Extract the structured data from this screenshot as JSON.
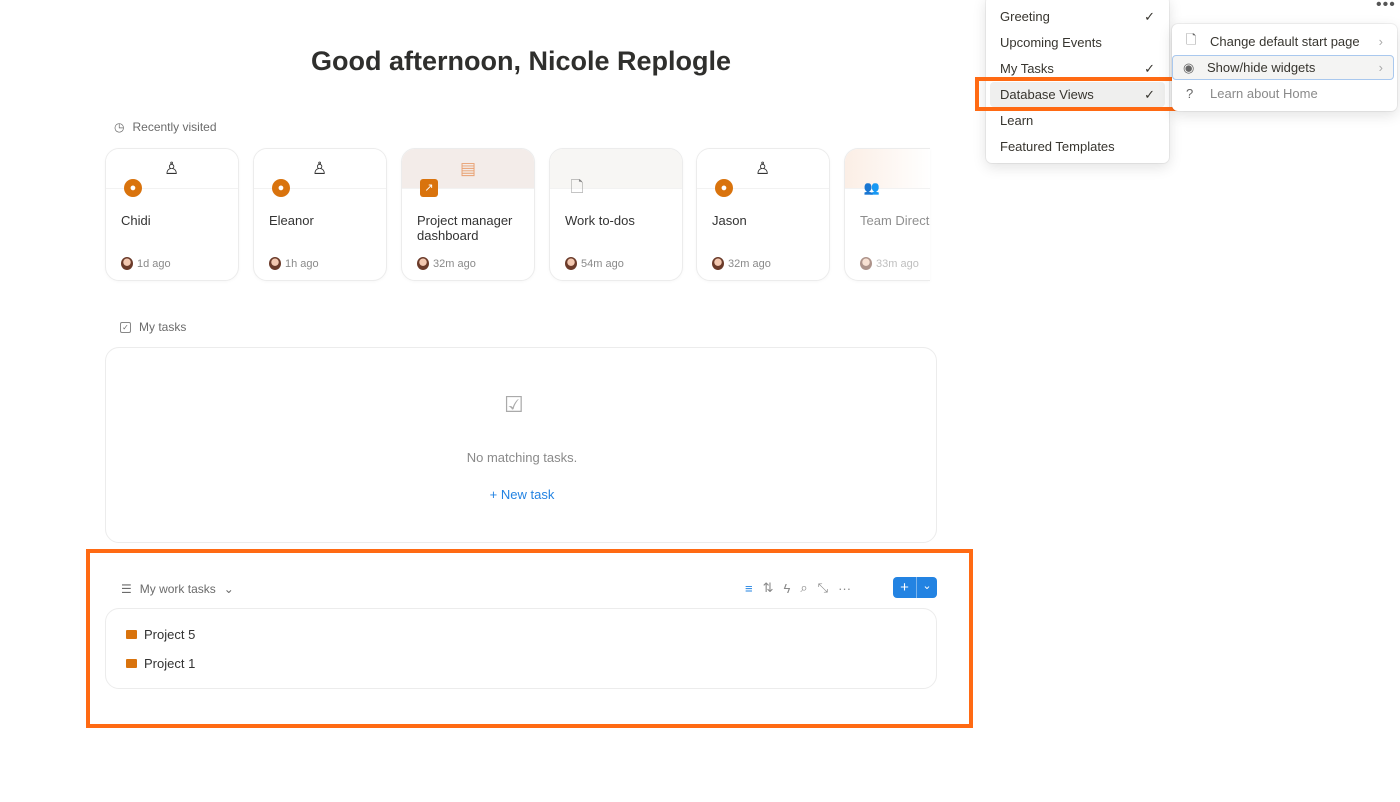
{
  "greeting": "Good afternoon, Nicole Replogle",
  "recently_visited": {
    "label": "Recently visited",
    "cards": [
      {
        "name": "Chidi",
        "time": "1d ago",
        "icon": "person-icon"
      },
      {
        "name": "Eleanor",
        "time": "1h ago",
        "icon": "person-icon"
      },
      {
        "name": "Project manager dashboard",
        "time": "32m ago",
        "icon": "chart-icon"
      },
      {
        "name": "Work to-dos",
        "time": "54m ago",
        "icon": "document-icon"
      },
      {
        "name": "Jason",
        "time": "32m ago",
        "icon": "person-icon"
      },
      {
        "name": "Team Directory",
        "time": "33m ago",
        "icon": "team-icon"
      }
    ]
  },
  "my_tasks": {
    "label": "My tasks",
    "empty_text": "No matching tasks.",
    "new_task": "New task"
  },
  "database": {
    "view_name": "My work tasks",
    "items": [
      "Project 5",
      "Project 1"
    ]
  },
  "widgets_menu": {
    "items": [
      {
        "label": "Greeting",
        "checked": true
      },
      {
        "label": "Upcoming Events",
        "checked": false
      },
      {
        "label": "My Tasks",
        "checked": true
      },
      {
        "label": "Database Views",
        "checked": true
      },
      {
        "label": "Learn",
        "checked": false
      },
      {
        "label": "Featured Templates",
        "checked": false
      }
    ]
  },
  "options_menu": {
    "items": [
      {
        "label": "Change default start page",
        "icon": "document-icon"
      },
      {
        "label": "Show/hide widgets",
        "icon": "eye-icon"
      },
      {
        "label": "Learn about Home",
        "icon": "help-icon"
      }
    ]
  },
  "colors": {
    "accent": "#d9730d",
    "highlight": "#ff6a13",
    "blue": "#2383e2"
  }
}
